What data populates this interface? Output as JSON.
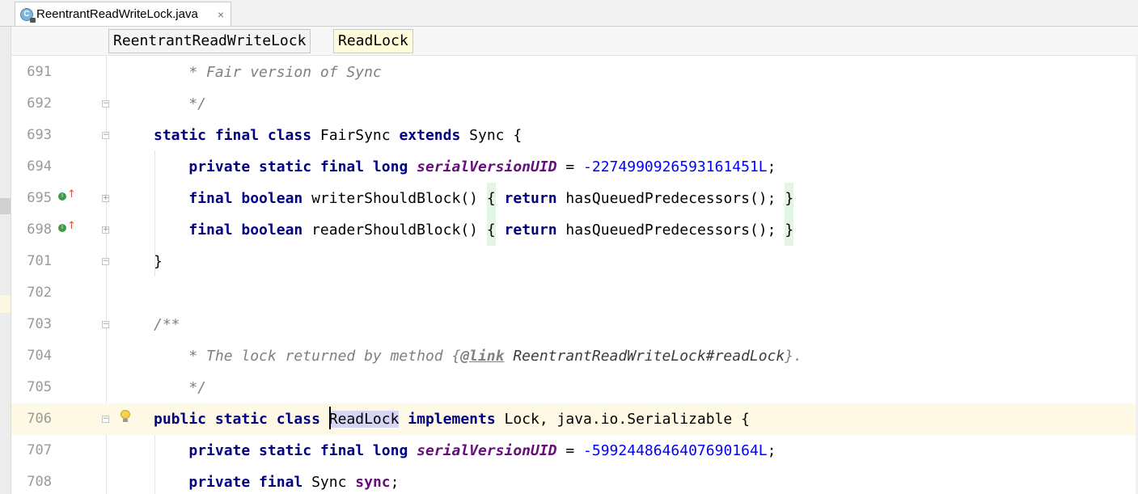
{
  "tab": {
    "title": "ReentrantReadWriteLock.java",
    "icon": "java-class-icon",
    "close": "×"
  },
  "breadcrumbs": [
    "ReentrantReadWriteLock",
    "ReadLock"
  ],
  "colors": {
    "keyword": "#000080",
    "comment": "#808080",
    "field": "#660e7a",
    "number": "#0000ff",
    "current_line": "#fdf9e4",
    "selection": "#d6d6f4",
    "brace_highlight": "#e3f6e3"
  },
  "lines": [
    {
      "num": "691",
      "t": [
        "    * Fair version of Sync"
      ]
    },
    {
      "num": "692",
      "t": [
        "    */"
      ]
    },
    {
      "num": "693",
      "t": [
        "static final class",
        " FairSync ",
        "extends",
        " Sync {"
      ]
    },
    {
      "num": "694",
      "t": [
        "    ",
        "private static final long",
        " ",
        "serialVersionUID",
        " = ",
        "-2274990926593161451L",
        ";"
      ]
    },
    {
      "num": "695",
      "t": [
        "    ",
        "final boolean",
        " writerShouldBlock() ",
        "{",
        " ",
        "return",
        " hasQueuedPredecessors(); ",
        "}"
      ]
    },
    {
      "num": "698",
      "t": [
        "    ",
        "final boolean",
        " readerShouldBlock() ",
        "{",
        " ",
        "return",
        " hasQueuedPredecessors(); ",
        "}"
      ]
    },
    {
      "num": "701",
      "t": [
        "}"
      ]
    },
    {
      "num": "702",
      "t": []
    },
    {
      "num": "703",
      "t": [
        "/**"
      ]
    },
    {
      "num": "704",
      "t": [
        "    * The lock returned by method {",
        "@link",
        " ReentrantReadWriteLock#readLock",
        "}."
      ]
    },
    {
      "num": "705",
      "t": [
        "    */"
      ]
    },
    {
      "num": "706",
      "t": [
        "public static class",
        " ",
        "ReadLock",
        " ",
        "implements",
        " Lock, java.io.Serializable {"
      ]
    },
    {
      "num": "707",
      "t": [
        "    ",
        "private static final long",
        " ",
        "serialVersionUID",
        " = ",
        "-5992448646407690164L",
        ";"
      ]
    },
    {
      "num": "708",
      "t": [
        "    ",
        "private final",
        " Sync ",
        "sync",
        ";"
      ]
    }
  ]
}
